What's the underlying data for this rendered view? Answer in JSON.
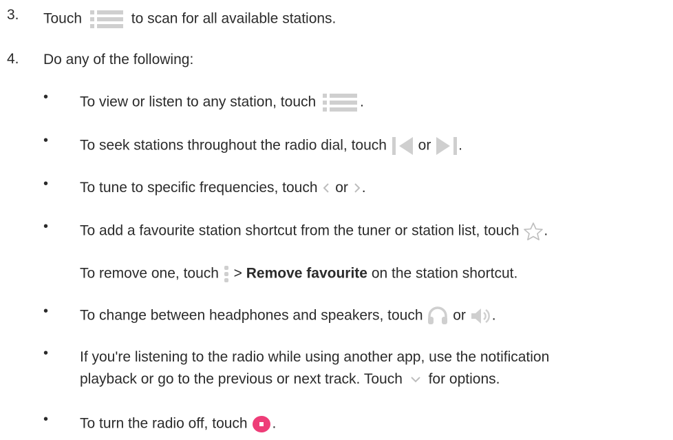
{
  "steps": [
    {
      "number": "3.",
      "before": "Touch",
      "after": "to scan for all available stations.",
      "icon": "station-list-icon"
    },
    {
      "number": "4.",
      "text": "Do any of the following:"
    }
  ],
  "bullets": {
    "view": {
      "before": "To view or listen to any station, touch",
      "after": ".",
      "icon": "station-list-icon"
    },
    "seek": {
      "before": "To seek stations throughout the radio dial, touch",
      "middle": "or",
      "after": ".",
      "icons": [
        "seek-previous-icon",
        "seek-next-icon"
      ]
    },
    "tune": {
      "before": "To tune to specific frequencies, touch",
      "middle": "or",
      "after": ".",
      "icons": [
        "chevron-left-icon",
        "chevron-right-icon"
      ]
    },
    "favourite": {
      "before": "To add a favourite station shortcut from the tuner or station list, touch",
      "after": ".",
      "icon": "star-outline-icon"
    },
    "remove": {
      "before": "To remove one, touch",
      "separator": ">",
      "bold": "Remove favourite",
      "after": "on the station shortcut.",
      "icon": "more-options-icon"
    },
    "audio": {
      "before": "To change between headphones and speakers, touch",
      "middle": "or",
      "after": ".",
      "icons": [
        "headphones-icon",
        "speaker-icon"
      ]
    },
    "notification": {
      "line1": "If you're listening to the radio while using another app, use the notification",
      "line2_before": "playback or go to the previous or next track. Touch",
      "line2_after": "for options.",
      "icon": "chevron-down-icon"
    },
    "off": {
      "before": "To turn the radio off, touch",
      "after": ".",
      "icon": "power-off-icon"
    }
  },
  "colors": {
    "text": "#2b2b2b",
    "icon_gray": "#cfcfcf",
    "power_pink": "#ee3d78"
  }
}
